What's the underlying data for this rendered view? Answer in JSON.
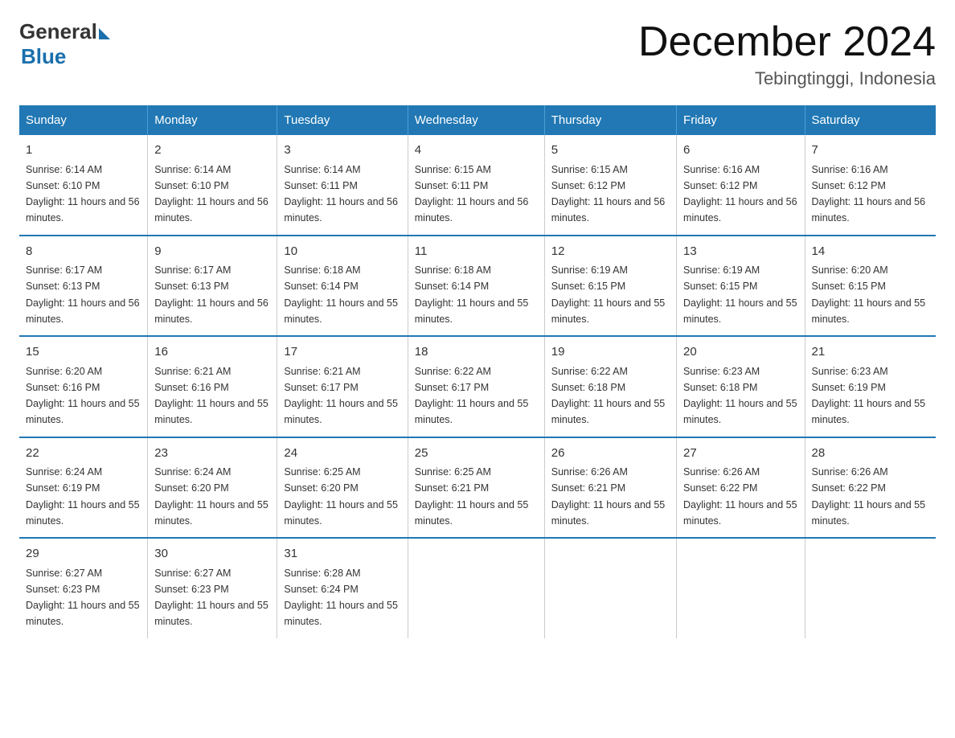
{
  "logo": {
    "general": "General",
    "blue": "Blue"
  },
  "title": "December 2024",
  "subtitle": "Tebingtinggi, Indonesia",
  "days_header": [
    "Sunday",
    "Monday",
    "Tuesday",
    "Wednesday",
    "Thursday",
    "Friday",
    "Saturday"
  ],
  "weeks": [
    [
      {
        "day": 1,
        "sunrise": "6:14 AM",
        "sunset": "6:10 PM",
        "daylight": "11 hours and 56 minutes."
      },
      {
        "day": 2,
        "sunrise": "6:14 AM",
        "sunset": "6:10 PM",
        "daylight": "11 hours and 56 minutes."
      },
      {
        "day": 3,
        "sunrise": "6:14 AM",
        "sunset": "6:11 PM",
        "daylight": "11 hours and 56 minutes."
      },
      {
        "day": 4,
        "sunrise": "6:15 AM",
        "sunset": "6:11 PM",
        "daylight": "11 hours and 56 minutes."
      },
      {
        "day": 5,
        "sunrise": "6:15 AM",
        "sunset": "6:12 PM",
        "daylight": "11 hours and 56 minutes."
      },
      {
        "day": 6,
        "sunrise": "6:16 AM",
        "sunset": "6:12 PM",
        "daylight": "11 hours and 56 minutes."
      },
      {
        "day": 7,
        "sunrise": "6:16 AM",
        "sunset": "6:12 PM",
        "daylight": "11 hours and 56 minutes."
      }
    ],
    [
      {
        "day": 8,
        "sunrise": "6:17 AM",
        "sunset": "6:13 PM",
        "daylight": "11 hours and 56 minutes."
      },
      {
        "day": 9,
        "sunrise": "6:17 AM",
        "sunset": "6:13 PM",
        "daylight": "11 hours and 56 minutes."
      },
      {
        "day": 10,
        "sunrise": "6:18 AM",
        "sunset": "6:14 PM",
        "daylight": "11 hours and 55 minutes."
      },
      {
        "day": 11,
        "sunrise": "6:18 AM",
        "sunset": "6:14 PM",
        "daylight": "11 hours and 55 minutes."
      },
      {
        "day": 12,
        "sunrise": "6:19 AM",
        "sunset": "6:15 PM",
        "daylight": "11 hours and 55 minutes."
      },
      {
        "day": 13,
        "sunrise": "6:19 AM",
        "sunset": "6:15 PM",
        "daylight": "11 hours and 55 minutes."
      },
      {
        "day": 14,
        "sunrise": "6:20 AM",
        "sunset": "6:15 PM",
        "daylight": "11 hours and 55 minutes."
      }
    ],
    [
      {
        "day": 15,
        "sunrise": "6:20 AM",
        "sunset": "6:16 PM",
        "daylight": "11 hours and 55 minutes."
      },
      {
        "day": 16,
        "sunrise": "6:21 AM",
        "sunset": "6:16 PM",
        "daylight": "11 hours and 55 minutes."
      },
      {
        "day": 17,
        "sunrise": "6:21 AM",
        "sunset": "6:17 PM",
        "daylight": "11 hours and 55 minutes."
      },
      {
        "day": 18,
        "sunrise": "6:22 AM",
        "sunset": "6:17 PM",
        "daylight": "11 hours and 55 minutes."
      },
      {
        "day": 19,
        "sunrise": "6:22 AM",
        "sunset": "6:18 PM",
        "daylight": "11 hours and 55 minutes."
      },
      {
        "day": 20,
        "sunrise": "6:23 AM",
        "sunset": "6:18 PM",
        "daylight": "11 hours and 55 minutes."
      },
      {
        "day": 21,
        "sunrise": "6:23 AM",
        "sunset": "6:19 PM",
        "daylight": "11 hours and 55 minutes."
      }
    ],
    [
      {
        "day": 22,
        "sunrise": "6:24 AM",
        "sunset": "6:19 PM",
        "daylight": "11 hours and 55 minutes."
      },
      {
        "day": 23,
        "sunrise": "6:24 AM",
        "sunset": "6:20 PM",
        "daylight": "11 hours and 55 minutes."
      },
      {
        "day": 24,
        "sunrise": "6:25 AM",
        "sunset": "6:20 PM",
        "daylight": "11 hours and 55 minutes."
      },
      {
        "day": 25,
        "sunrise": "6:25 AM",
        "sunset": "6:21 PM",
        "daylight": "11 hours and 55 minutes."
      },
      {
        "day": 26,
        "sunrise": "6:26 AM",
        "sunset": "6:21 PM",
        "daylight": "11 hours and 55 minutes."
      },
      {
        "day": 27,
        "sunrise": "6:26 AM",
        "sunset": "6:22 PM",
        "daylight": "11 hours and 55 minutes."
      },
      {
        "day": 28,
        "sunrise": "6:26 AM",
        "sunset": "6:22 PM",
        "daylight": "11 hours and 55 minutes."
      }
    ],
    [
      {
        "day": 29,
        "sunrise": "6:27 AM",
        "sunset": "6:23 PM",
        "daylight": "11 hours and 55 minutes."
      },
      {
        "day": 30,
        "sunrise": "6:27 AM",
        "sunset": "6:23 PM",
        "daylight": "11 hours and 55 minutes."
      },
      {
        "day": 31,
        "sunrise": "6:28 AM",
        "sunset": "6:24 PM",
        "daylight": "11 hours and 55 minutes."
      },
      null,
      null,
      null,
      null
    ]
  ]
}
